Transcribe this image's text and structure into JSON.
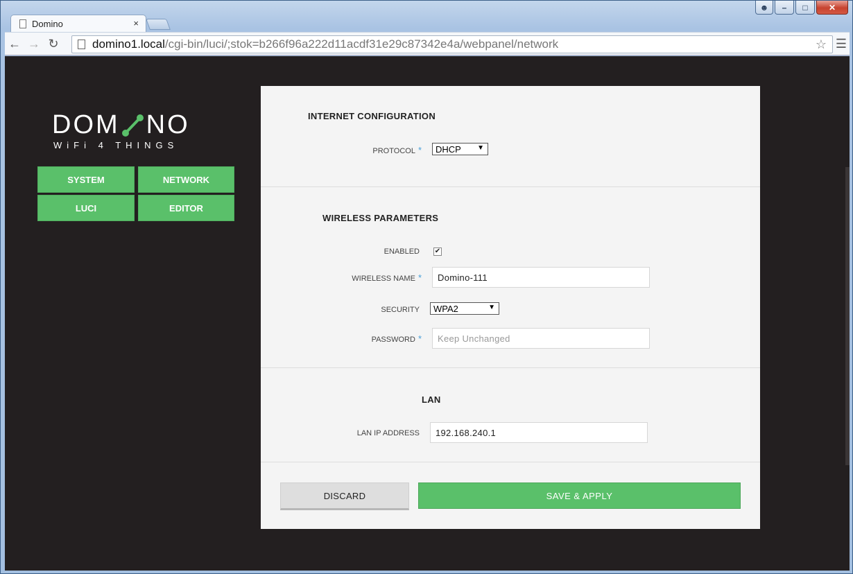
{
  "window": {
    "controls": [
      "user-icon",
      "minimize-icon",
      "maximize-icon",
      "close-icon"
    ]
  },
  "tab": {
    "title": "Domino",
    "close_glyph": "×"
  },
  "address_bar": {
    "host": "domino1.local",
    "path": "/cgi-bin/luci/;stok=b266f96a222d11acdf31e29c87342e4a/webpanel/network"
  },
  "logo": {
    "word_left": "DOM",
    "word_right": "NO",
    "tagline": "WiFi 4 THINGS",
    "accent": "#5ac06a"
  },
  "menu": [
    {
      "label": "SYSTEM"
    },
    {
      "label": "NETWORK"
    },
    {
      "label": "LUCI"
    },
    {
      "label": "EDITOR"
    }
  ],
  "internet": {
    "title": "INTERNET CONFIGURATION",
    "protocol_label": "PROTOCOL",
    "protocol_value": "DHCP"
  },
  "wireless": {
    "title": "WIRELESS PARAMETERS",
    "enabled_label": "ENABLED",
    "enabled": true,
    "name_label": "WIRELESS NAME",
    "name_value": "Domino-111",
    "security_label": "SECURITY",
    "security_value": "WPA2",
    "password_label": "PASSWORD",
    "password_placeholder": "Keep Unchanged"
  },
  "lan": {
    "title": "LAN",
    "ip_label": "LAN IP ADDRESS",
    "ip_value": "192.168.240.1"
  },
  "actions": {
    "discard": "DISCARD",
    "save": "SAVE & APPLY"
  },
  "required_marker": "*"
}
